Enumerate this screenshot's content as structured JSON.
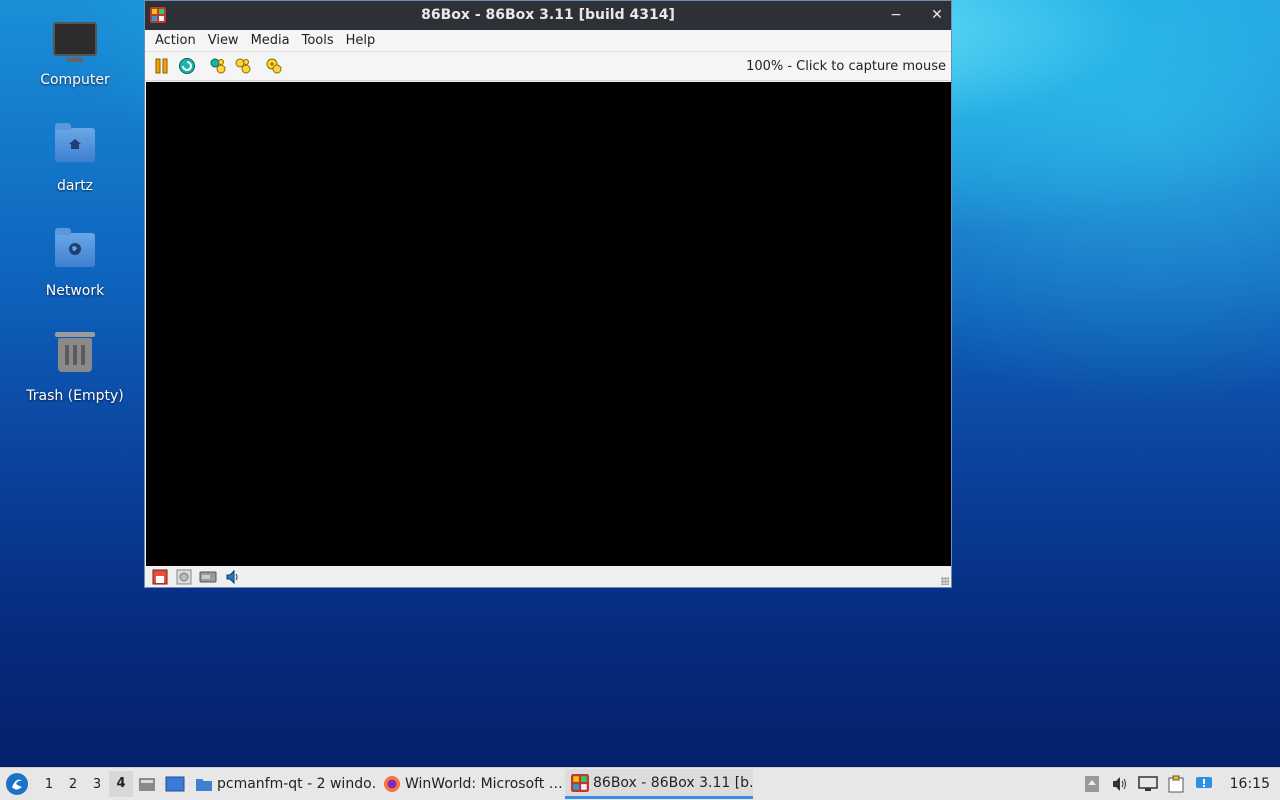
{
  "desktop": {
    "icons": [
      {
        "label": "Computer",
        "icon": "computer-icon"
      },
      {
        "label": "dartz",
        "icon": "home-folder-icon"
      },
      {
        "label": "Network",
        "icon": "network-folder-icon"
      },
      {
        "label": "Trash (Empty)",
        "icon": "trash-icon"
      }
    ]
  },
  "window": {
    "title": "86Box - 86Box 3.11 [build 4314]",
    "minimize": "−",
    "close": "✕",
    "menu": [
      "Action",
      "View",
      "Media",
      "Tools",
      "Help"
    ],
    "toolbar": {
      "buttons": [
        "pause-icon",
        "reset-icon",
        "ctrl-alt-del-icon",
        "ctrl-alt-esc-icon",
        "settings-icon"
      ],
      "status": "100% - Click to capture mouse"
    },
    "statusbar": [
      "floppy-drive-icon",
      "cdrom-drive-icon",
      "hard-disk-icon",
      "sound-icon"
    ]
  },
  "taskbar": {
    "workspaces": [
      "1",
      "2",
      "3",
      "4"
    ],
    "active_workspace": "4",
    "tasks": [
      {
        "label": "pcmanfm-qt - 2 windo…",
        "icon": "folder-icon"
      },
      {
        "label": "WinWorld: Microsoft …",
        "icon": "firefox-icon"
      },
      {
        "label": "86Box - 86Box 3.11 [b…",
        "icon": "86box-icon"
      }
    ],
    "clock": "16:15"
  }
}
